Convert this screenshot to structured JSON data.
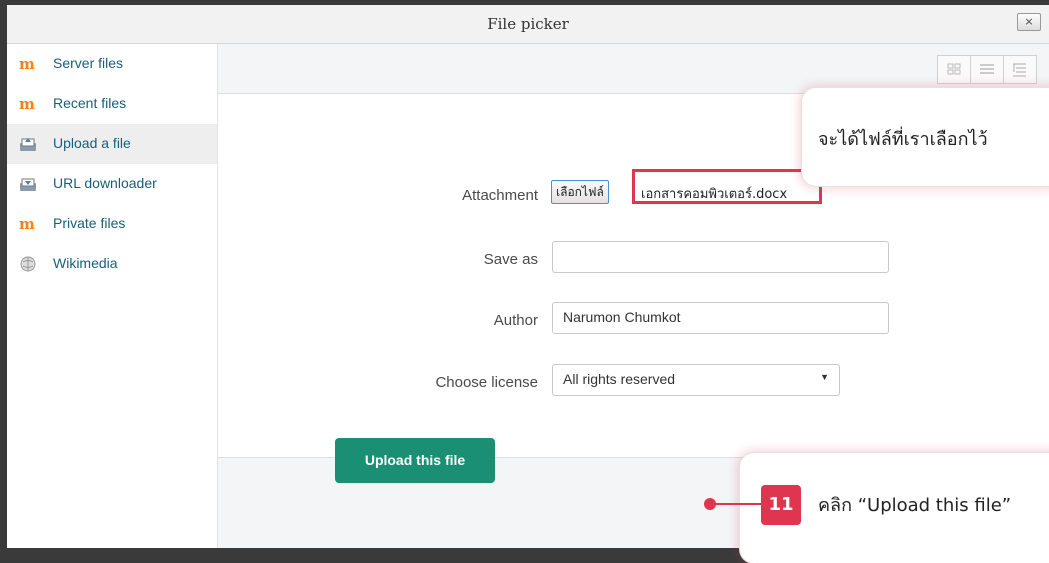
{
  "window": {
    "title": "File picker",
    "close_label": "×"
  },
  "sidebar": {
    "items": [
      {
        "label": "Server files",
        "icon": "moodle-icon"
      },
      {
        "label": "Recent files",
        "icon": "moodle-icon"
      },
      {
        "label": "Upload a file",
        "icon": "upload-icon",
        "active": true
      },
      {
        "label": "URL downloader",
        "icon": "download-icon"
      },
      {
        "label": "Private files",
        "icon": "moodle-icon"
      },
      {
        "label": "Wikimedia",
        "icon": "wikimedia-icon"
      }
    ]
  },
  "toolbar": {
    "views": [
      "icons-view-icon",
      "list-view-icon",
      "tree-view-icon"
    ]
  },
  "form": {
    "attachment_label": "Attachment",
    "choose_file_button": "เลือกไฟล์",
    "chosen_file": "เอกสารคอมพิวเตอร์.docx",
    "save_as_label": "Save as",
    "save_as_value": "",
    "author_label": "Author",
    "author_value": "Narumon Chumkot",
    "license_label": "Choose license",
    "license_value": "All rights reserved",
    "upload_button": "Upload this file"
  },
  "annotations": {
    "callout_text": "จะได้ไฟล์ที่เราเลือกไว้",
    "step_number": "11",
    "step_text": "คลิก “Upload this file”",
    "accent_color": "#e0354f"
  },
  "colors": {
    "brand_green": "#1b8f74",
    "link_blue": "#1a5e7a",
    "moodle_orange": "#f98012"
  }
}
